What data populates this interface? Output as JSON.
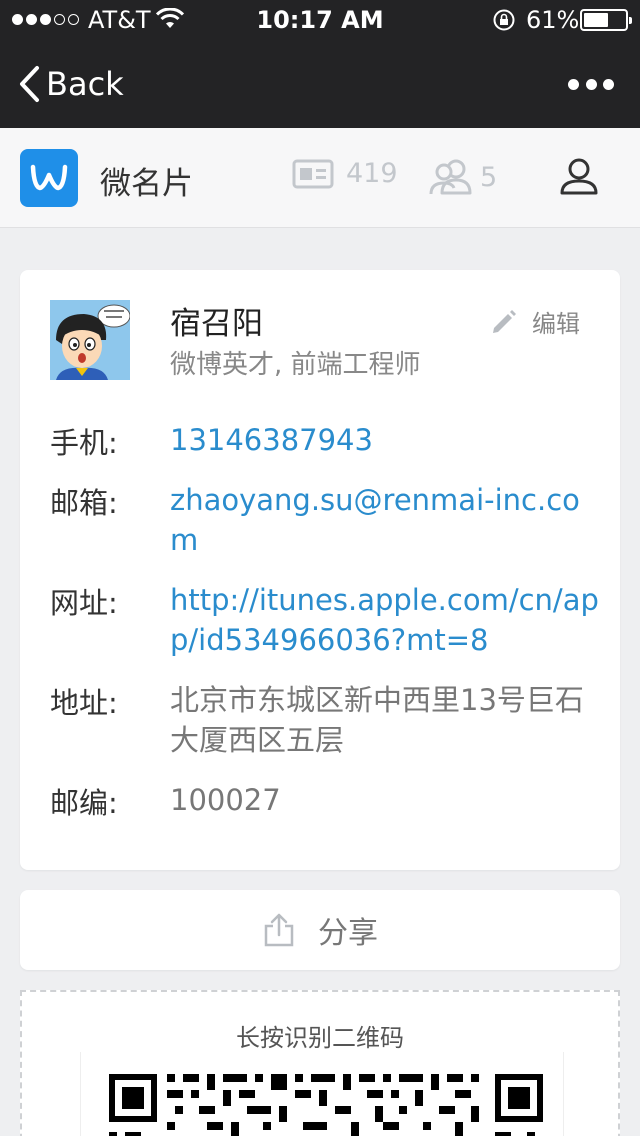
{
  "status_bar": {
    "carrier": "AT&T",
    "time": "10:17 AM",
    "battery": "61%"
  },
  "nav": {
    "back_label": "Back"
  },
  "app_header": {
    "title": "微名片",
    "card_count": "419",
    "friend_count": "5",
    "brand_color": "#1f8fe8"
  },
  "profile": {
    "name": "宿召阳",
    "title": "微博英才, 前端工程师",
    "edit_label": "编辑",
    "fields": [
      {
        "label": "手机:",
        "value": "13146387943",
        "kind": "link"
      },
      {
        "label": "邮箱:",
        "value": "zhaoyang.su@renmai-inc.com",
        "kind": "link"
      },
      {
        "label": "网址:",
        "value": "http://itunes.apple.com/cn/app/id534966036?mt=8",
        "kind": "link"
      },
      {
        "label": "地址:",
        "value": "北京市东城区新中西里13号巨石大厦西区五层",
        "kind": "plain"
      },
      {
        "label": "邮编:",
        "value": "100027",
        "kind": "plain"
      }
    ],
    "link_color": "#2a8ccd"
  },
  "share": {
    "label": "分享"
  },
  "qr": {
    "caption": "长按识别二维码"
  }
}
